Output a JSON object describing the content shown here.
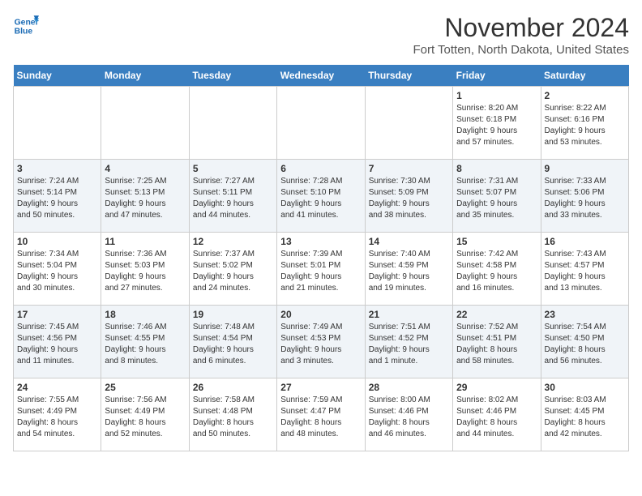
{
  "header": {
    "logo_line1": "General",
    "logo_line2": "Blue",
    "title": "November 2024",
    "subtitle": "Fort Totten, North Dakota, United States"
  },
  "weekdays": [
    "Sunday",
    "Monday",
    "Tuesday",
    "Wednesday",
    "Thursday",
    "Friday",
    "Saturday"
  ],
  "weeks": [
    [
      {
        "day": "",
        "info": ""
      },
      {
        "day": "",
        "info": ""
      },
      {
        "day": "",
        "info": ""
      },
      {
        "day": "",
        "info": ""
      },
      {
        "day": "",
        "info": ""
      },
      {
        "day": "1",
        "info": "Sunrise: 8:20 AM\nSunset: 6:18 PM\nDaylight: 9 hours\nand 57 minutes."
      },
      {
        "day": "2",
        "info": "Sunrise: 8:22 AM\nSunset: 6:16 PM\nDaylight: 9 hours\nand 53 minutes."
      }
    ],
    [
      {
        "day": "3",
        "info": "Sunrise: 7:24 AM\nSunset: 5:14 PM\nDaylight: 9 hours\nand 50 minutes."
      },
      {
        "day": "4",
        "info": "Sunrise: 7:25 AM\nSunset: 5:13 PM\nDaylight: 9 hours\nand 47 minutes."
      },
      {
        "day": "5",
        "info": "Sunrise: 7:27 AM\nSunset: 5:11 PM\nDaylight: 9 hours\nand 44 minutes."
      },
      {
        "day": "6",
        "info": "Sunrise: 7:28 AM\nSunset: 5:10 PM\nDaylight: 9 hours\nand 41 minutes."
      },
      {
        "day": "7",
        "info": "Sunrise: 7:30 AM\nSunset: 5:09 PM\nDaylight: 9 hours\nand 38 minutes."
      },
      {
        "day": "8",
        "info": "Sunrise: 7:31 AM\nSunset: 5:07 PM\nDaylight: 9 hours\nand 35 minutes."
      },
      {
        "day": "9",
        "info": "Sunrise: 7:33 AM\nSunset: 5:06 PM\nDaylight: 9 hours\nand 33 minutes."
      }
    ],
    [
      {
        "day": "10",
        "info": "Sunrise: 7:34 AM\nSunset: 5:04 PM\nDaylight: 9 hours\nand 30 minutes."
      },
      {
        "day": "11",
        "info": "Sunrise: 7:36 AM\nSunset: 5:03 PM\nDaylight: 9 hours\nand 27 minutes."
      },
      {
        "day": "12",
        "info": "Sunrise: 7:37 AM\nSunset: 5:02 PM\nDaylight: 9 hours\nand 24 minutes."
      },
      {
        "day": "13",
        "info": "Sunrise: 7:39 AM\nSunset: 5:01 PM\nDaylight: 9 hours\nand 21 minutes."
      },
      {
        "day": "14",
        "info": "Sunrise: 7:40 AM\nSunset: 4:59 PM\nDaylight: 9 hours\nand 19 minutes."
      },
      {
        "day": "15",
        "info": "Sunrise: 7:42 AM\nSunset: 4:58 PM\nDaylight: 9 hours\nand 16 minutes."
      },
      {
        "day": "16",
        "info": "Sunrise: 7:43 AM\nSunset: 4:57 PM\nDaylight: 9 hours\nand 13 minutes."
      }
    ],
    [
      {
        "day": "17",
        "info": "Sunrise: 7:45 AM\nSunset: 4:56 PM\nDaylight: 9 hours\nand 11 minutes."
      },
      {
        "day": "18",
        "info": "Sunrise: 7:46 AM\nSunset: 4:55 PM\nDaylight: 9 hours\nand 8 minutes."
      },
      {
        "day": "19",
        "info": "Sunrise: 7:48 AM\nSunset: 4:54 PM\nDaylight: 9 hours\nand 6 minutes."
      },
      {
        "day": "20",
        "info": "Sunrise: 7:49 AM\nSunset: 4:53 PM\nDaylight: 9 hours\nand 3 minutes."
      },
      {
        "day": "21",
        "info": "Sunrise: 7:51 AM\nSunset: 4:52 PM\nDaylight: 9 hours\nand 1 minute."
      },
      {
        "day": "22",
        "info": "Sunrise: 7:52 AM\nSunset: 4:51 PM\nDaylight: 8 hours\nand 58 minutes."
      },
      {
        "day": "23",
        "info": "Sunrise: 7:54 AM\nSunset: 4:50 PM\nDaylight: 8 hours\nand 56 minutes."
      }
    ],
    [
      {
        "day": "24",
        "info": "Sunrise: 7:55 AM\nSunset: 4:49 PM\nDaylight: 8 hours\nand 54 minutes."
      },
      {
        "day": "25",
        "info": "Sunrise: 7:56 AM\nSunset: 4:49 PM\nDaylight: 8 hours\nand 52 minutes."
      },
      {
        "day": "26",
        "info": "Sunrise: 7:58 AM\nSunset: 4:48 PM\nDaylight: 8 hours\nand 50 minutes."
      },
      {
        "day": "27",
        "info": "Sunrise: 7:59 AM\nSunset: 4:47 PM\nDaylight: 8 hours\nand 48 minutes."
      },
      {
        "day": "28",
        "info": "Sunrise: 8:00 AM\nSunset: 4:46 PM\nDaylight: 8 hours\nand 46 minutes."
      },
      {
        "day": "29",
        "info": "Sunrise: 8:02 AM\nSunset: 4:46 PM\nDaylight: 8 hours\nand 44 minutes."
      },
      {
        "day": "30",
        "info": "Sunrise: 8:03 AM\nSunset: 4:45 PM\nDaylight: 8 hours\nand 42 minutes."
      }
    ]
  ]
}
